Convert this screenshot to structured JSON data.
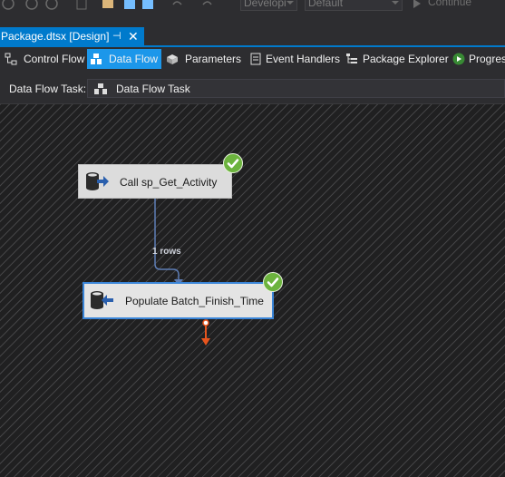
{
  "toolbar": {
    "solution_config": "Developi",
    "platform": "Default",
    "continue_label": "Continue"
  },
  "document_tab": {
    "title": "Package.dtsx [Design]",
    "pin_glyph": "⊣",
    "close_glyph": "✕",
    "accent": "#007acc"
  },
  "designer_tabs": [
    {
      "label": "Control Flow",
      "icon": "control-flow-icon"
    },
    {
      "label": "Data Flow",
      "icon": "data-flow-icon",
      "selected": true
    },
    {
      "label": "Parameters",
      "icon": "parameters-icon"
    },
    {
      "label": "Event Handlers",
      "icon": "event-handlers-icon"
    },
    {
      "label": "Package Explorer",
      "icon": "package-explorer-icon"
    },
    {
      "label": "Progress",
      "icon": "progress-icon"
    }
  ],
  "task_selector": {
    "label": "Data Flow Task:",
    "value": "Data Flow Task"
  },
  "canvas": {
    "components": [
      {
        "name": "Call sp_Get_Activity",
        "status": "success",
        "icon": "source-db-icon"
      },
      {
        "name": "Populate Batch_Finish_Time",
        "status": "success",
        "icon": "destination-db-icon"
      }
    ],
    "path_label": "1 rows",
    "colors": {
      "success": "#6cb33e",
      "error_output": "#e8551e",
      "path": "#5d7db5"
    }
  }
}
